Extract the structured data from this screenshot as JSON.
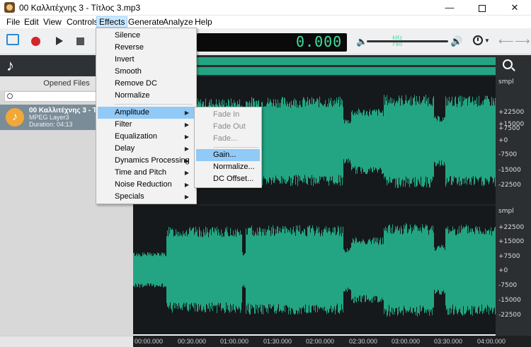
{
  "window": {
    "title": "00 Καλλιτέχνης 3 - Τίτλος 3.mp3",
    "controls": {
      "minimize": "—",
      "close": "✕"
    }
  },
  "menubar": [
    "File",
    "Edit",
    "View",
    "Controls",
    "Effects",
    "Generate",
    "Analyze",
    "Help"
  ],
  "toolbar": {
    "lcd_small_top": "kHz",
    "lcd_small_bottom": "reo",
    "lcd_time": "0.000",
    "volume_level": 0.96,
    "nav_back": "⟵",
    "nav_forward": "⟶"
  },
  "sidebar": {
    "header": "Opened Files",
    "search_placeholder": "",
    "file": {
      "name": "00 Καλλιτέχνης 3 - Τίτ",
      "type": "MPEG Layer3",
      "duration": "Duration: 04:13"
    }
  },
  "effects_menu": {
    "items": [
      "Silence",
      "Reverse",
      "Invert",
      "Smooth",
      "Remove DC",
      "Normalize"
    ],
    "submenus": [
      "Amplitude",
      "Filter",
      "Equalization",
      "Delay",
      "Dynamics Processing",
      "Time and Pitch",
      "Noise Reduction",
      "Specials"
    ]
  },
  "amplitude_submenu": {
    "disabled": [
      "Fade In",
      "Fade Out",
      "Fade..."
    ],
    "enabled": [
      "Gain...",
      "Normalize...",
      "DC Offset..."
    ]
  },
  "ruler": {
    "unit_top": "smpl",
    "unit_bottom": "smpl",
    "labels": [
      "+22500",
      "+15000",
      "+7500",
      "+0",
      "-7500",
      "-15000",
      "-22500"
    ]
  },
  "timeline": [
    "00:00.000",
    "00:30.000",
    "01:00.000",
    "01:30.000",
    "02:00.000",
    "02:30.000",
    "03:00.000",
    "03:30.000",
    "04:00.000"
  ],
  "colors": {
    "waveform": "#23a583",
    "highlight": "#91c9f7",
    "background": "#16191b"
  }
}
